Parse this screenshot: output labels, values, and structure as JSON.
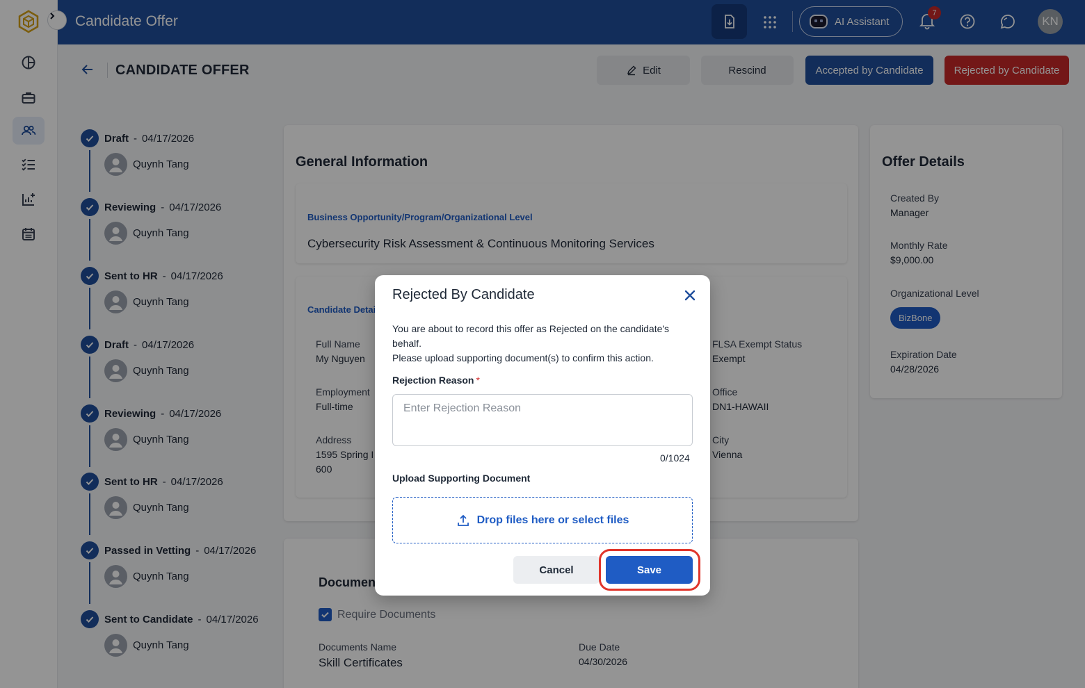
{
  "app": {
    "title": "Candidate Offer"
  },
  "topbar": {
    "download_icon": "download-icon",
    "apps_icon": "apps-grid-icon",
    "ai_assistant_label": "AI Assistant",
    "notification_count": "7",
    "avatar_initials": "KN"
  },
  "rail": {
    "items": [
      "dashboard-icon",
      "briefcase-icon",
      "people-icon",
      "checklist-icon",
      "report-icon",
      "calendar-icon"
    ],
    "active": "people-icon"
  },
  "page": {
    "title": "CANDIDATE OFFER",
    "buttons": {
      "edit": "Edit",
      "rescind": "Rescind",
      "accepted": "Accepted by Candidate",
      "rejected": "Rejected by Candidate"
    }
  },
  "timeline": [
    {
      "status": "Draft",
      "date": "04/17/2026",
      "user": "Quynh Tang"
    },
    {
      "status": "Reviewing",
      "date": "04/17/2026",
      "user": "Quynh Tang"
    },
    {
      "status": "Sent to HR",
      "date": "04/17/2026",
      "user": "Quynh Tang"
    },
    {
      "status": "Draft",
      "date": "04/17/2026",
      "user": "Quynh Tang"
    },
    {
      "status": "Reviewing",
      "date": "04/17/2026",
      "user": "Quynh Tang"
    },
    {
      "status": "Sent to HR",
      "date": "04/17/2026",
      "user": "Quynh Tang"
    },
    {
      "status": "Passed in Vetting",
      "date": "04/17/2026",
      "user": "Quynh Tang"
    },
    {
      "status": "Sent to Candidate",
      "date": "04/17/2026",
      "user": "Quynh Tang"
    }
  ],
  "general": {
    "title": "General Information",
    "bo_label": "Business Opportunity/Program/Organizational Level",
    "bo_value": "Cybersecurity Risk Assessment & Continuous Monitoring Services",
    "candidate_label": "Candidate Detai",
    "full_name_label": "Full Name",
    "full_name_value": "My Nguyen",
    "employment_label": "Employment",
    "employment_value": "Full-time",
    "address_label": "Address",
    "address_line1": "1595 Spring I",
    "address_line2": "600",
    "flsa_label": "FLSA Exempt Status",
    "flsa_value": "Exempt",
    "office_label": "Office",
    "office_value": "DN1-HAWAII",
    "city_label": "City",
    "city_value": "Vienna"
  },
  "documents": {
    "title": "Documen",
    "require_label": "Require Documents",
    "name_label": "Documents Name",
    "name_value": "Skill Certificates",
    "due_label": "Due Date",
    "due_value": "04/30/2026"
  },
  "offer": {
    "title": "Offer Details",
    "created_by_label": "Created By",
    "created_by_value": "Manager",
    "monthly_rate_label": "Monthly Rate",
    "monthly_rate_value": "$9,000.00",
    "org_level_label": "Organizational Level",
    "org_level_value": "BizBone",
    "expiration_label": "Expiration Date",
    "expiration_value": "04/28/2026"
  },
  "modal": {
    "title": "Rejected By Candidate",
    "message_line1": "You are about to record this offer as Rejected on the candidate's behalf.",
    "message_line2": "Please upload supporting document(s) to confirm this action.",
    "reason_label": "Rejection Reason",
    "required_mark": "*",
    "reason_placeholder": "Enter Rejection Reason",
    "reason_value": "",
    "counter": "0/1024",
    "upload_label": "Upload Supporting Document",
    "drop_text": "Drop files here or select files",
    "cancel_label": "Cancel",
    "save_label": "Save"
  },
  "colors": {
    "brand": "#1f4e9c",
    "primary": "#1f5cc4",
    "danger": "#c62828",
    "highlight": "#e0352b"
  }
}
